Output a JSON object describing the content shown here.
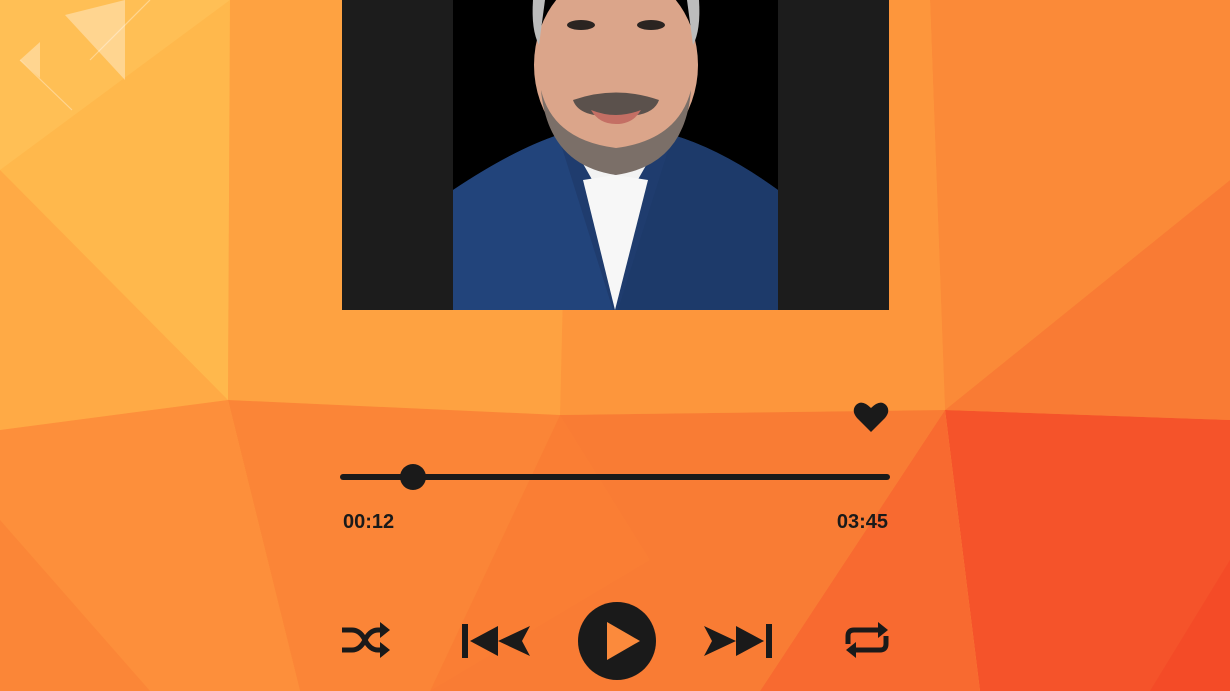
{
  "player": {
    "colors": {
      "accent_dark": "#1a1a1a",
      "background_light": "#ffb347",
      "background_mid": "#fb8a3c",
      "background_red": "#f5522a",
      "album_frame": "#1c1c1c"
    },
    "album_art": {
      "icon": "portrait-photo"
    },
    "favorite": {
      "icon": "heart-icon",
      "active": true
    },
    "progress": {
      "current_time": "00:12",
      "total_time": "03:45",
      "fraction": 0.133
    },
    "controls": {
      "shuffle_icon": "shuffle-icon",
      "prev_icon": "skip-previous-icon",
      "play_icon": "play-icon",
      "next_icon": "skip-next-icon",
      "repeat_icon": "repeat-icon"
    }
  }
}
